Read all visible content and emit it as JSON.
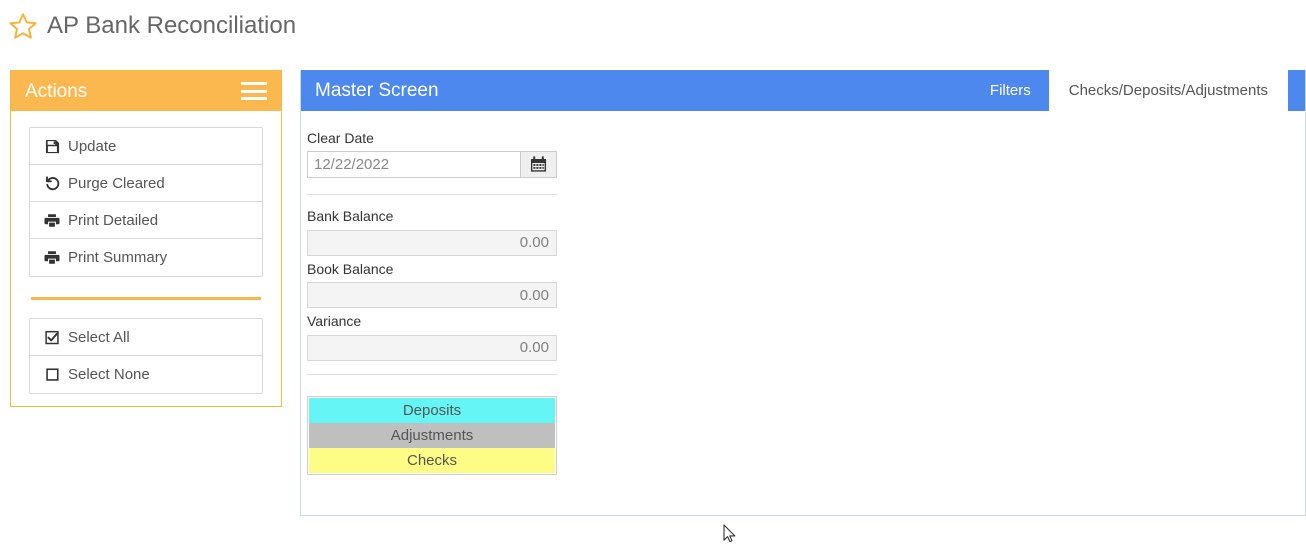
{
  "page": {
    "title": "AP Bank Reconciliation",
    "favorite_icon": "star-outline-icon"
  },
  "colors": {
    "accent_orange": "#fbb84f",
    "accent_blue": "#4c88ee",
    "deposits": "#66f5f5",
    "adjustments": "#bfbfbf",
    "checks": "#fdfd86",
    "title_text": "#666666"
  },
  "actions_panel": {
    "header_title": "Actions",
    "menu_icon": "hamburger-menu-icon",
    "buttons": [
      {
        "label": "Update",
        "icon": "save-floppy-icon"
      },
      {
        "label": "Purge Cleared",
        "icon": "undo-rotate-left-icon"
      },
      {
        "label": "Print Detailed",
        "icon": "printer-icon"
      },
      {
        "label": "Print Summary",
        "icon": "printer-icon"
      }
    ],
    "selection_buttons": [
      {
        "label": "Select All",
        "icon": "checkbox-checked-icon"
      },
      {
        "label": "Select None",
        "icon": "checkbox-empty-icon"
      }
    ]
  },
  "main_panel": {
    "header_title": "Master Screen",
    "tabs": [
      {
        "label": "Filters",
        "active": false
      },
      {
        "label": "Checks/Deposits/Adjustments",
        "active": true
      }
    ],
    "clear_date": {
      "label": "Clear Date",
      "value": "12/22/2022",
      "placeholder": "",
      "calendar_icon": "calendar-icon"
    },
    "balances": [
      {
        "label": "Bank Balance",
        "value": "0.00"
      },
      {
        "label": "Book Balance",
        "value": "0.00"
      },
      {
        "label": "Variance",
        "value": "0.00"
      }
    ],
    "legend": [
      {
        "label": "Deposits",
        "color": "#66f5f5"
      },
      {
        "label": "Adjustments",
        "color": "#bfbfbf"
      },
      {
        "label": "Checks",
        "color": "#fdfd86"
      }
    ]
  }
}
